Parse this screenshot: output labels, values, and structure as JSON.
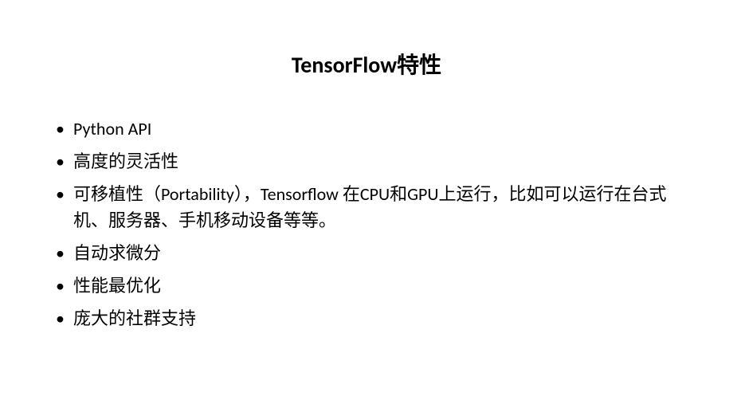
{
  "title": "TensorFlow特性",
  "bullets": [
    "Python API",
    "高度的灵活性",
    "可移植性（Portability），Tensorflow 在CPU和GPU上运行，比如可以运行在台式机、服务器、手机移动设备等等。",
    "自动求微分",
    "性能最优化",
    "庞大的社群支持"
  ]
}
